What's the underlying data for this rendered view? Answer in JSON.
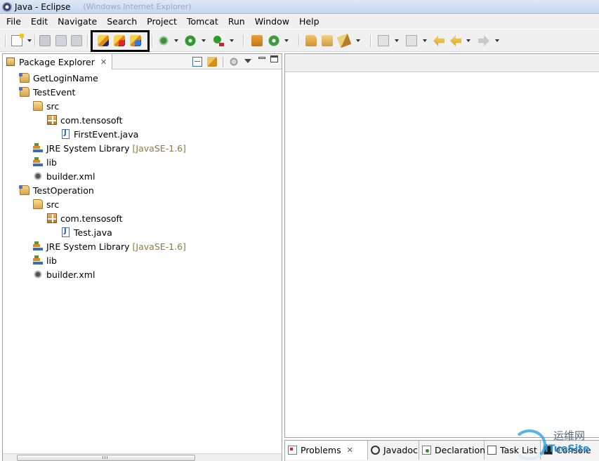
{
  "window": {
    "title": "Java - Eclipse",
    "ghost_title": "(Windows Internet Explorer)"
  },
  "menu": [
    "File",
    "Edit",
    "Navigate",
    "Search",
    "Project",
    "Tomcat",
    "Run",
    "Window",
    "Help"
  ],
  "toolbar": {
    "icons": [
      "new-wizard-icon",
      "save-icon",
      "save-all-icon",
      "print-icon",
      "tomcat-start-icon",
      "tomcat-stop-icon",
      "tomcat-restart-icon",
      "debug-icon",
      "run-icon",
      "external-tools-icon",
      "new-java-package-icon",
      "new-java-class-icon",
      "open-type-icon",
      "open-task-icon",
      "search-icon",
      "next-annotation-icon",
      "previous-annotation-icon",
      "last-edit-location-icon",
      "back-icon",
      "forward-icon"
    ],
    "highlighted_group": [
      "tomcat-start-icon",
      "tomcat-stop-icon",
      "tomcat-restart-icon"
    ]
  },
  "explorer": {
    "tab_label": "Package Explorer",
    "close_glyph": "✕",
    "tree": [
      {
        "label": "GetLoginName",
        "icon": "java-project-icon",
        "depth": 0
      },
      {
        "label": "TestEvent",
        "icon": "java-project-icon",
        "depth": 0
      },
      {
        "label": "src",
        "icon": "source-folder-icon",
        "depth": 1
      },
      {
        "label": "com.tensosoft",
        "icon": "package-icon",
        "depth": 2
      },
      {
        "label": "FirstEvent.java",
        "icon": "java-file-icon",
        "depth": 3
      },
      {
        "label": "JRE System Library",
        "decoration": "[JavaSE-1.6]",
        "icon": "library-icon",
        "depth": 1
      },
      {
        "label": "lib",
        "icon": "library-icon",
        "depth": 1
      },
      {
        "label": "builder.xml",
        "icon": "ant-file-icon",
        "depth": 1
      },
      {
        "label": "TestOperation",
        "icon": "java-project-icon",
        "depth": 0
      },
      {
        "label": "src",
        "icon": "source-folder-icon",
        "depth": 1
      },
      {
        "label": "com.tensosoft",
        "icon": "package-icon",
        "depth": 2
      },
      {
        "label": "Test.java",
        "icon": "java-file-icon",
        "depth": 3
      },
      {
        "label": "JRE System Library",
        "decoration": "[JavaSE-1.6]",
        "icon": "library-icon",
        "depth": 1
      },
      {
        "label": "lib",
        "icon": "library-icon",
        "depth": 1
      },
      {
        "label": "builder.xml",
        "icon": "ant-file-icon",
        "depth": 1
      }
    ]
  },
  "bottom_tabs": [
    {
      "label": "Problems",
      "icon": "problems-icon"
    },
    {
      "label": "Javadoc",
      "icon": "javadoc-icon"
    },
    {
      "label": "Declaration",
      "icon": "declaration-icon"
    },
    {
      "label": "Task List",
      "icon": "task-list-icon"
    },
    {
      "label": "Console",
      "icon": "console-icon"
    }
  ],
  "watermark": {
    "line1": "运维网",
    "line2": "iTuoSite"
  },
  "colors": {
    "decoration": "#8f7a3a",
    "highlight_border": "#000000",
    "titlebar": "#c4d6ec"
  }
}
